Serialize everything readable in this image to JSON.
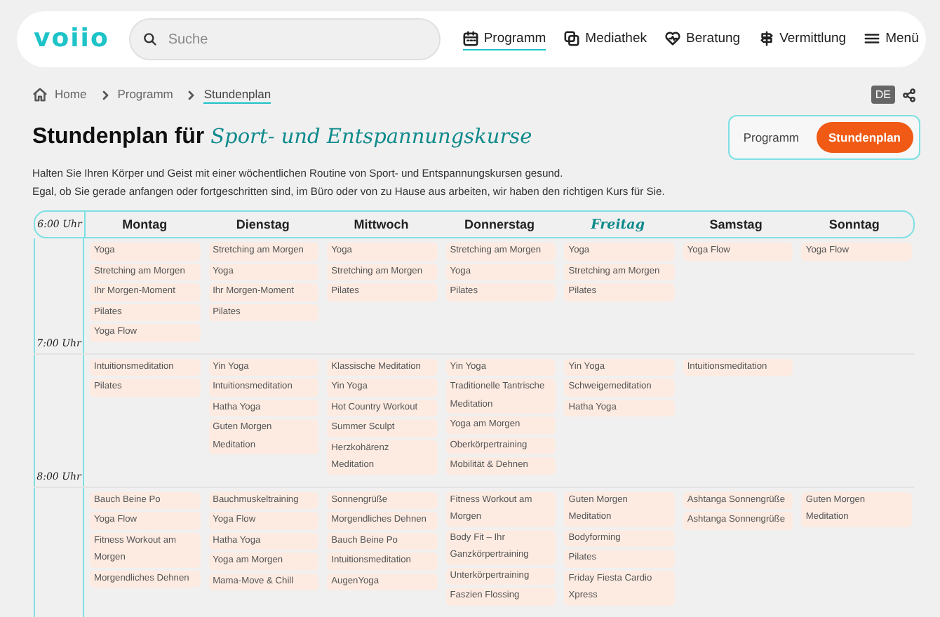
{
  "header": {
    "logo": "voiio",
    "search": {
      "placeholder": "Suche"
    },
    "nav": [
      {
        "label": "Programm",
        "selected": true
      },
      {
        "label": "Mediathek",
        "selected": false
      },
      {
        "label": "Beratung",
        "selected": false
      },
      {
        "label": "Vermittlung",
        "selected": false
      },
      {
        "label": "Menü",
        "selected": false
      }
    ]
  },
  "breadcrumb": [
    {
      "label": "Home",
      "current": false
    },
    {
      "label": "Programm",
      "current": false
    },
    {
      "label": "Stundenplan",
      "current": true
    }
  ],
  "language": "DE",
  "title": "Stundenplan für *Sport- und Entspannungskurse*",
  "view_toggle": [
    {
      "label": "Programm",
      "selected": false
    },
    {
      "label": "Stundenplan",
      "selected": true
    }
  ],
  "intro": [
    "Halten Sie Ihren Körper und Geist mit einer wöchentlichen Routine von Sport- und Entspannungskursen gesund.",
    "Egal, ob Sie gerade anfangen oder fortgeschritten sind, im Büro oder von zu Hause aus arbeiten, wir haben den richtigen Kurs für Sie."
  ],
  "schedule": {
    "time_labels": [
      "6:00 Uhr",
      "7:00 Uhr",
      "8:00 Uhr"
    ],
    "days": [
      {
        "label": "Montag",
        "today": false
      },
      {
        "label": "Dienstag",
        "today": false
      },
      {
        "label": "Mittwoch",
        "today": false
      },
      {
        "label": "Donnerstag",
        "today": false
      },
      {
        "label": "Freitag",
        "today": true
      },
      {
        "label": "Samstag",
        "today": false
      },
      {
        "label": "Sonntag",
        "today": false
      }
    ],
    "slots": [
      {
        "days": [
          [
            "Yoga",
            "Stretching am Morgen",
            "Ihr Morgen-Moment",
            "Pilates",
            "Yoga Flow"
          ],
          [
            "Stretching am Morgen",
            "Yoga",
            "Ihr Morgen-Moment",
            "Pilates"
          ],
          [
            "Yoga",
            "Stretching am Morgen",
            "Pilates"
          ],
          [
            "Stretching am Morgen",
            "Yoga",
            "Pilates"
          ],
          [
            "Yoga",
            "Stretching am Morgen",
            "Pilates"
          ],
          [
            "Yoga Flow"
          ],
          [
            "Yoga Flow"
          ]
        ]
      },
      {
        "days": [
          [
            "Intuitionsmeditation",
            "Pilates"
          ],
          [
            "Yin Yoga",
            "Intuitionsmeditation",
            "Hatha Yoga",
            "Guten Morgen Meditation"
          ],
          [
            "Klassische Meditation",
            "Yin Yoga",
            "Hot Country Workout",
            "Summer Sculpt",
            "Herzkohärenz Meditation"
          ],
          [
            "Yin Yoga",
            "Traditionelle Tantrische Meditation",
            "Yoga am Morgen",
            "Oberkörpertraining",
            "Mobilität & Dehnen"
          ],
          [
            "Yin Yoga",
            "Schweigemeditation",
            "Hatha Yoga"
          ],
          [
            "Intuitionsmeditation"
          ]
        ]
      },
      {
        "days": [
          [
            "Bauch Beine Po",
            "Yoga Flow",
            "Fitness Workout am Morgen",
            "Morgendliches Dehnen"
          ],
          [
            "Bauchmuskeltraining",
            "Yoga Flow",
            "Hatha Yoga",
            "Yoga am Morgen",
            "Mama-Move & Chill"
          ],
          [
            "Sonnengrüße",
            "Morgendliches Dehnen",
            "Bauch Beine Po",
            "Intuitionsmeditation",
            "AugenYoga"
          ],
          [
            "Fitness Workout am Morgen",
            "Body Fit – Ihr Ganzkörpertraining",
            "Unterkörpertraining",
            "Faszien Flossing"
          ],
          [
            "Guten Morgen Meditation",
            "Bodyforming",
            "Pilates",
            "Friday Fiesta Cardio Xpress"
          ],
          [
            "Ashtanga Sonnengrüße",
            "Ashtanga Sonnengrüße"
          ],
          [
            "Guten Morgen Meditation"
          ]
        ]
      }
    ]
  }
}
